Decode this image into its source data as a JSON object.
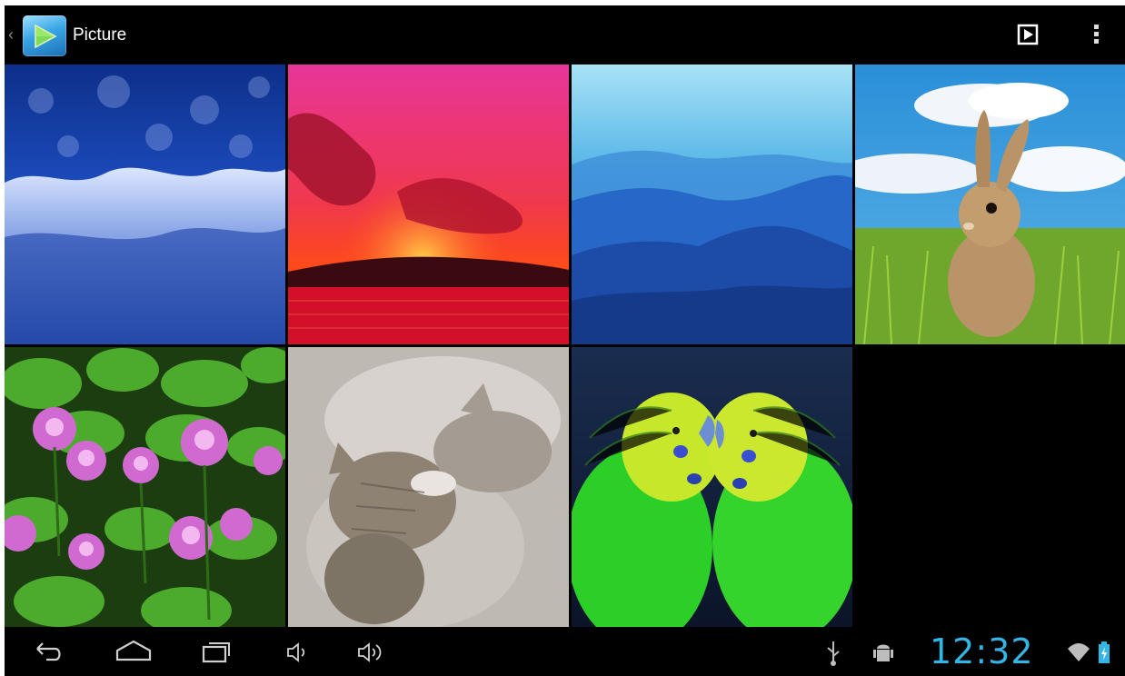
{
  "action_bar": {
    "title": "Picture",
    "app_icon": "gallery-play-icon",
    "actions": [
      {
        "icon": "slideshow-icon"
      },
      {
        "icon": "overflow-menu-icon"
      }
    ]
  },
  "gallery": {
    "thumbnails": [
      {
        "subject": "frosted-blue-forest"
      },
      {
        "subject": "red-sunset-sea"
      },
      {
        "subject": "blue-mountains"
      },
      {
        "subject": "rabbit-in-grass"
      },
      {
        "subject": "pink-water-lilies"
      },
      {
        "subject": "sleeping-kittens"
      },
      {
        "subject": "green-parakeets"
      }
    ]
  },
  "nav_bar": {
    "buttons": [
      {
        "icon": "back-icon"
      },
      {
        "icon": "home-icon"
      },
      {
        "icon": "recent-apps-icon"
      },
      {
        "icon": "volume-down-icon"
      },
      {
        "icon": "volume-up-icon"
      }
    ]
  },
  "status": {
    "time": "12:32",
    "icons": [
      "usb-icon",
      "android-debug-icon",
      "wifi-icon",
      "battery-icon"
    ]
  },
  "colors": {
    "background": "#000000",
    "clock": "#33b5e5",
    "title": "#ffffff",
    "icons": "#cfcfcf"
  }
}
